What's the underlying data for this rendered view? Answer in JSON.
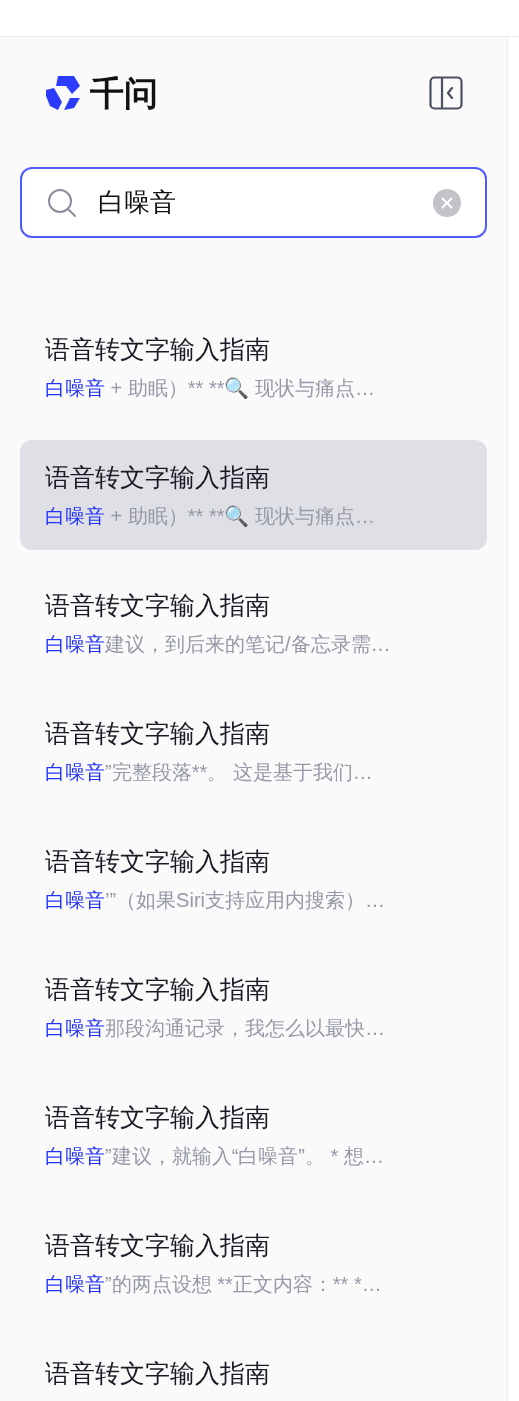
{
  "brand": {
    "name": "千问"
  },
  "search": {
    "value": "白噪音"
  },
  "results": [
    {
      "title": "语音转文字输入指南",
      "match": "白噪音",
      "rest": " + 助眠）** **🔍 现状与痛点…",
      "selected": false
    },
    {
      "title": "语音转文字输入指南",
      "match": "白噪音",
      "rest": " + 助眠）** **🔍 现状与痛点…",
      "selected": true
    },
    {
      "title": "语音转文字输入指南",
      "match": "白噪音",
      "rest": "建议，到后来的笔记/备忘录需…",
      "selected": false
    },
    {
      "title": "语音转文字输入指南",
      "match": "白噪音",
      "rest": "”完整段落**。 这是基于我们…",
      "selected": false
    },
    {
      "title": "语音转文字输入指南",
      "match": "白噪音",
      "rest": "’”（如果Siri支持应用内搜索）…",
      "selected": false
    },
    {
      "title": "语音转文字输入指南",
      "match": "白噪音",
      "rest": "那段沟通记录，我怎么以最快…",
      "selected": false
    },
    {
      "title": "语音转文字输入指南",
      "match": "白噪音",
      "rest": "”建议，就输入“白噪音”。 * 想…",
      "selected": false
    },
    {
      "title": "语音转文字输入指南",
      "match": "白噪音",
      "rest": "”的两点设想 **正文内容：** *…",
      "selected": false
    },
    {
      "title": "语音转文字输入指南",
      "selected": false
    }
  ]
}
